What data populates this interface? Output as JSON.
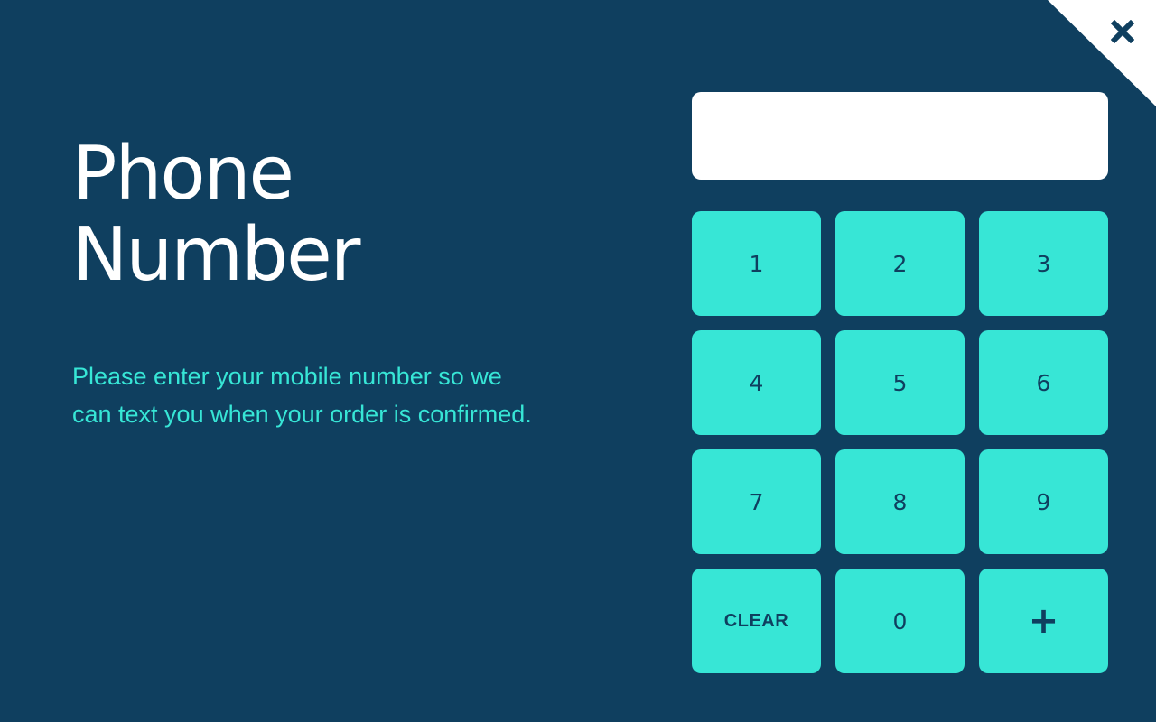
{
  "title_lines": [
    "Phone",
    "Number"
  ],
  "description": "Please enter your mobile number so we can text you when your order is confirmed.",
  "phone_input": {
    "value": "",
    "placeholder": ""
  },
  "keypad": [
    {
      "label": "1",
      "name": "key-1"
    },
    {
      "label": "2",
      "name": "key-2"
    },
    {
      "label": "3",
      "name": "key-3"
    },
    {
      "label": "4",
      "name": "key-4"
    },
    {
      "label": "5",
      "name": "key-5"
    },
    {
      "label": "6",
      "name": "key-6"
    },
    {
      "label": "7",
      "name": "key-7"
    },
    {
      "label": "8",
      "name": "key-8"
    },
    {
      "label": "9",
      "name": "key-9"
    },
    {
      "label": "CLEAR",
      "name": "clear-button"
    },
    {
      "label": "0",
      "name": "key-0"
    },
    {
      "label": "+",
      "name": "plus-button"
    }
  ],
  "close_icon": "close-icon",
  "colors": {
    "background": "#0f3f5f",
    "accent": "#37e6d6",
    "text": "#ffffff"
  }
}
